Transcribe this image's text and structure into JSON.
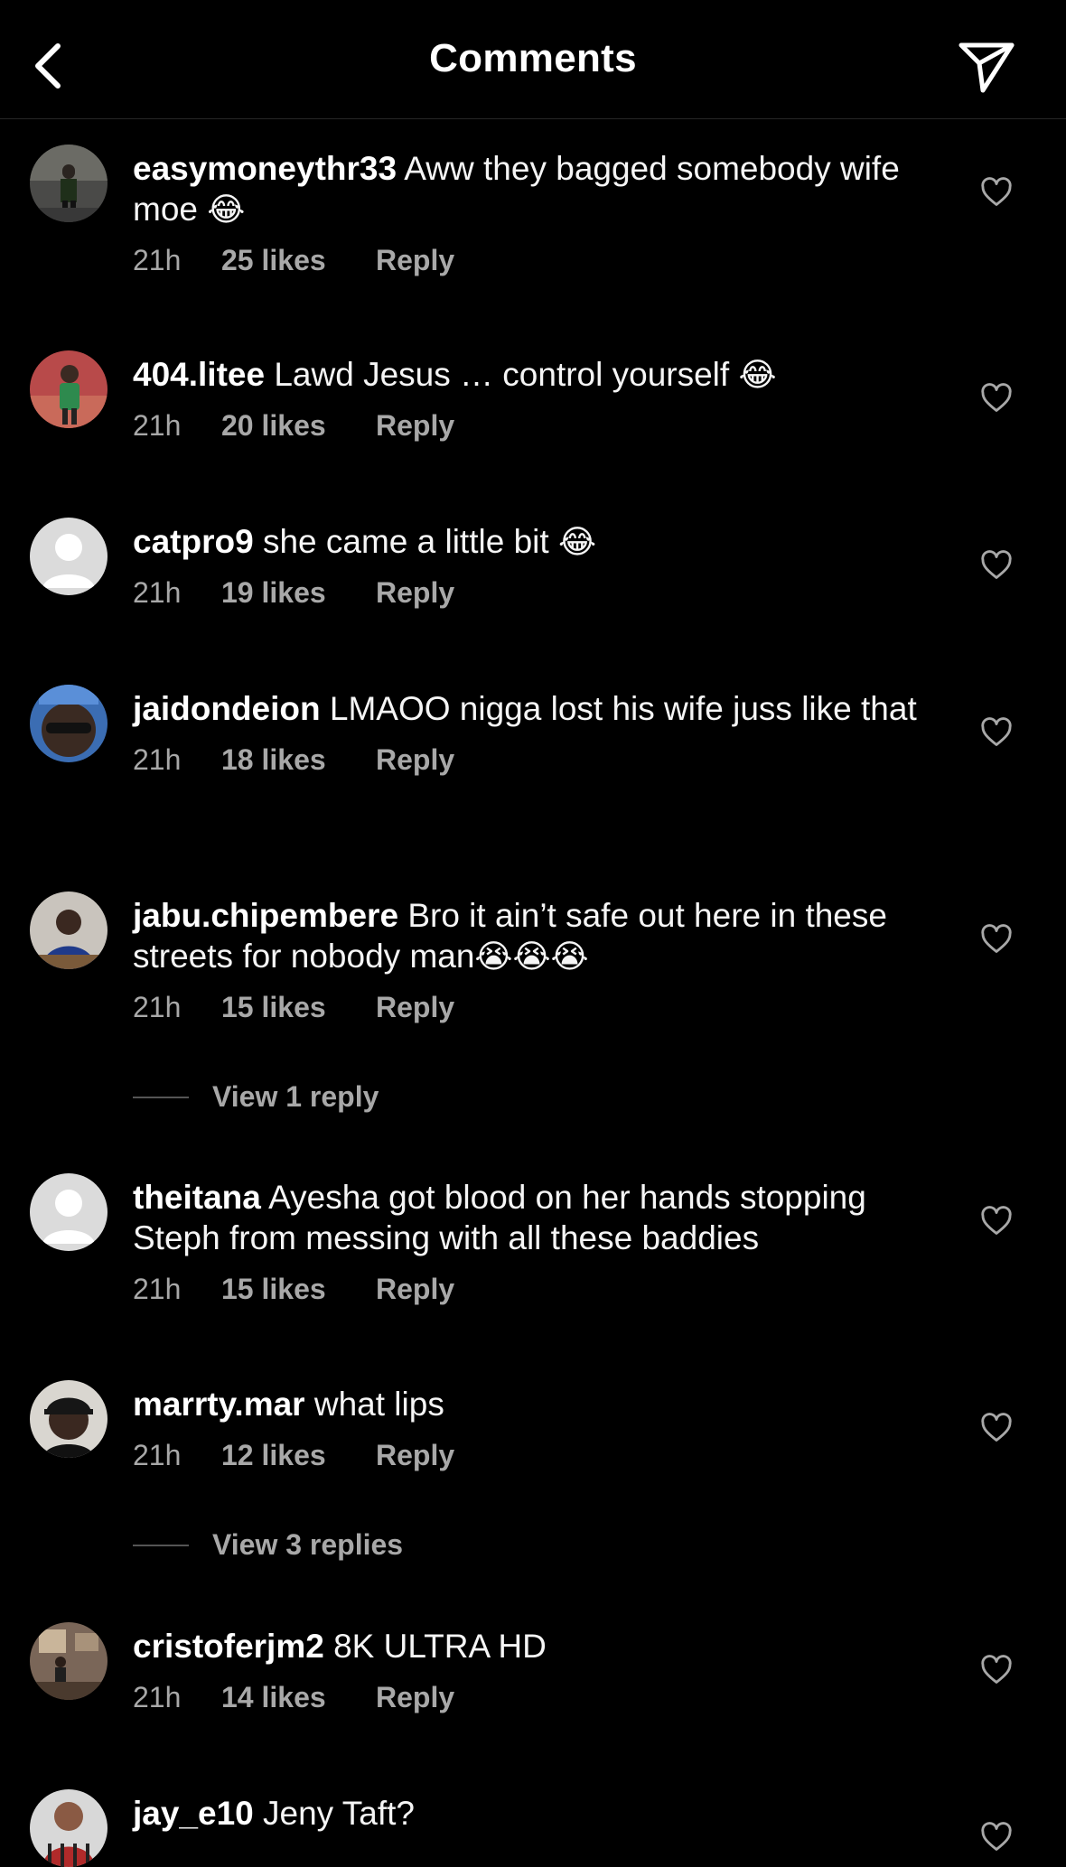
{
  "header": {
    "title": "Comments",
    "back_icon": "chevron-left-icon",
    "send_icon": "paper-plane-icon"
  },
  "comments": [
    {
      "username": "easymoneythr33",
      "text": "Aww they bagged somebody wife moe",
      "emoji": "😂",
      "time": "21h",
      "likes": "25 likes",
      "reply": "Reply"
    },
    {
      "username": "404.litee",
      "text": "Lawd Jesus … control yourself",
      "emoji": "😂",
      "time": "21h",
      "likes": "20 likes",
      "reply": "Reply"
    },
    {
      "username": "catpro9",
      "text": "she came a little bit",
      "emoji": "😂",
      "time": "21h",
      "likes": "19 likes",
      "reply": "Reply"
    },
    {
      "username": "jaidondeion",
      "text": "LMAOO nigga lost his wife juss like that",
      "emoji": "",
      "time": "21h",
      "likes": "18 likes",
      "reply": "Reply"
    },
    {
      "username": "jabu.chipembere",
      "text": "Bro it ain’t safe out here in these streets for nobody man",
      "emoji": "😭😭😭",
      "time": "21h",
      "likes": "15 likes",
      "reply": "Reply",
      "view_replies": "View 1 reply"
    },
    {
      "username": "theitana",
      "text": "Ayesha got blood on her hands stopping Steph from messing with all these baddies",
      "emoji": "",
      "time": "21h",
      "likes": "15 likes",
      "reply": "Reply"
    },
    {
      "username": "marrty.mar",
      "text": "what lips",
      "emoji": "",
      "time": "21h",
      "likes": "12 likes",
      "reply": "Reply",
      "view_replies": "View 3 replies"
    },
    {
      "username": "cristoferjm2",
      "text": "8K ULTRA HD",
      "emoji": "",
      "time": "21h",
      "likes": "14 likes",
      "reply": "Reply"
    },
    {
      "username": "jay_e10",
      "text": "Jeny Taft?",
      "emoji": "",
      "time": "",
      "likes": "",
      "reply": ""
    }
  ],
  "colors": {
    "background": "#000000",
    "text": "#ffffff",
    "secondary_text": "#a8a8a8"
  }
}
